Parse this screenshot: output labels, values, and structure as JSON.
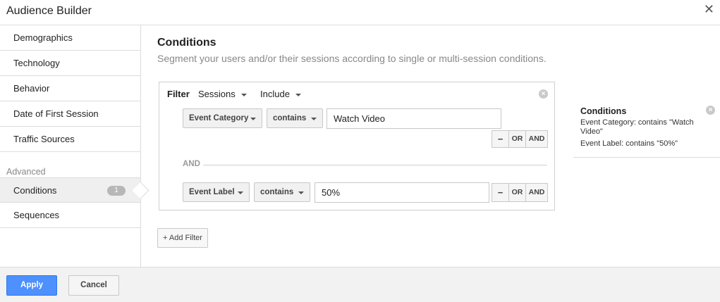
{
  "window": {
    "title": "Audience Builder",
    "close_icon": "close-icon"
  },
  "sidebar": {
    "items": [
      {
        "label": "Demographics"
      },
      {
        "label": "Technology"
      },
      {
        "label": "Behavior"
      },
      {
        "label": "Date of First Session"
      },
      {
        "label": "Traffic Sources"
      }
    ],
    "advanced_heading": "Advanced",
    "advanced_items": [
      {
        "label": "Conditions",
        "badge": "1",
        "active": true
      },
      {
        "label": "Sequences"
      }
    ]
  },
  "main": {
    "title": "Conditions",
    "subtitle": "Segment your users and/or their sessions according to single or multi-session conditions.",
    "filter": {
      "label": "Filter",
      "scope": "Sessions",
      "mode": "Include",
      "rows": [
        {
          "dimension": "Event Category",
          "operator": "contains",
          "value": "Watch Video"
        },
        {
          "dimension": "Event Label",
          "operator": "contains",
          "value": "50%"
        }
      ],
      "minus_label": "−",
      "or_label": "OR",
      "and_label": "AND",
      "separator_label": "AND"
    },
    "add_filter_label": "+ Add Filter"
  },
  "summary": {
    "title": "Conditions",
    "line1a": "Event Category: contains \"Watch",
    "line1b": "Video\"",
    "line2": "Event Label: contains \"50%\""
  },
  "footer": {
    "apply_label": "Apply",
    "cancel_label": "Cancel"
  },
  "colors": {
    "accent": "#4d90fe",
    "border": "#dcdcdc"
  }
}
